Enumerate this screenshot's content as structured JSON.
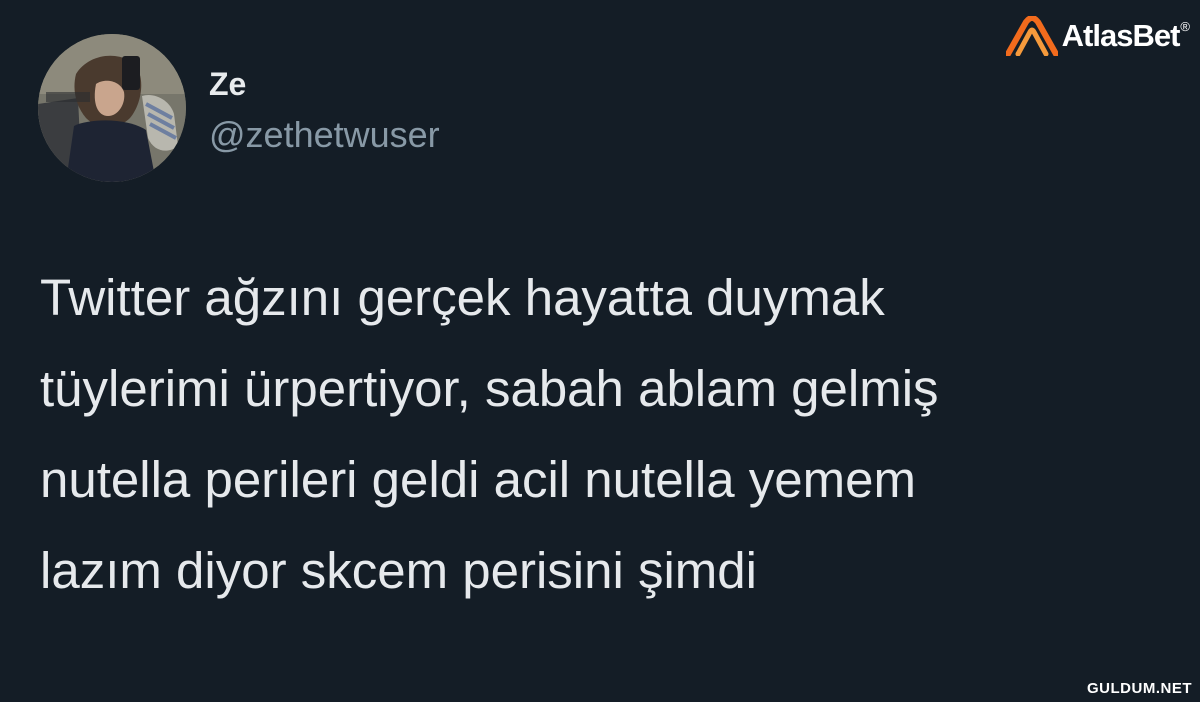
{
  "tweet": {
    "display_name": "Ze",
    "handle": "@zethetwuser",
    "text_lines": [
      "Twitter ağzını gerçek hayatta duymak",
      "tüylerimi ürpertiyor, sabah ablam gelmiş",
      "nutella perileri geldi acil nutella yemem",
      "lazım diyor skcem perisini şimdi"
    ]
  },
  "branding": {
    "logo_name": "AtlasBet",
    "registered_mark": "®",
    "logo_accent_color": "#f26b1d"
  },
  "watermark": {
    "text": "GULDUM.NET"
  },
  "colors": {
    "background": "#141d26",
    "primary_text": "#e6e9ec",
    "secondary_text": "#8899a6"
  }
}
